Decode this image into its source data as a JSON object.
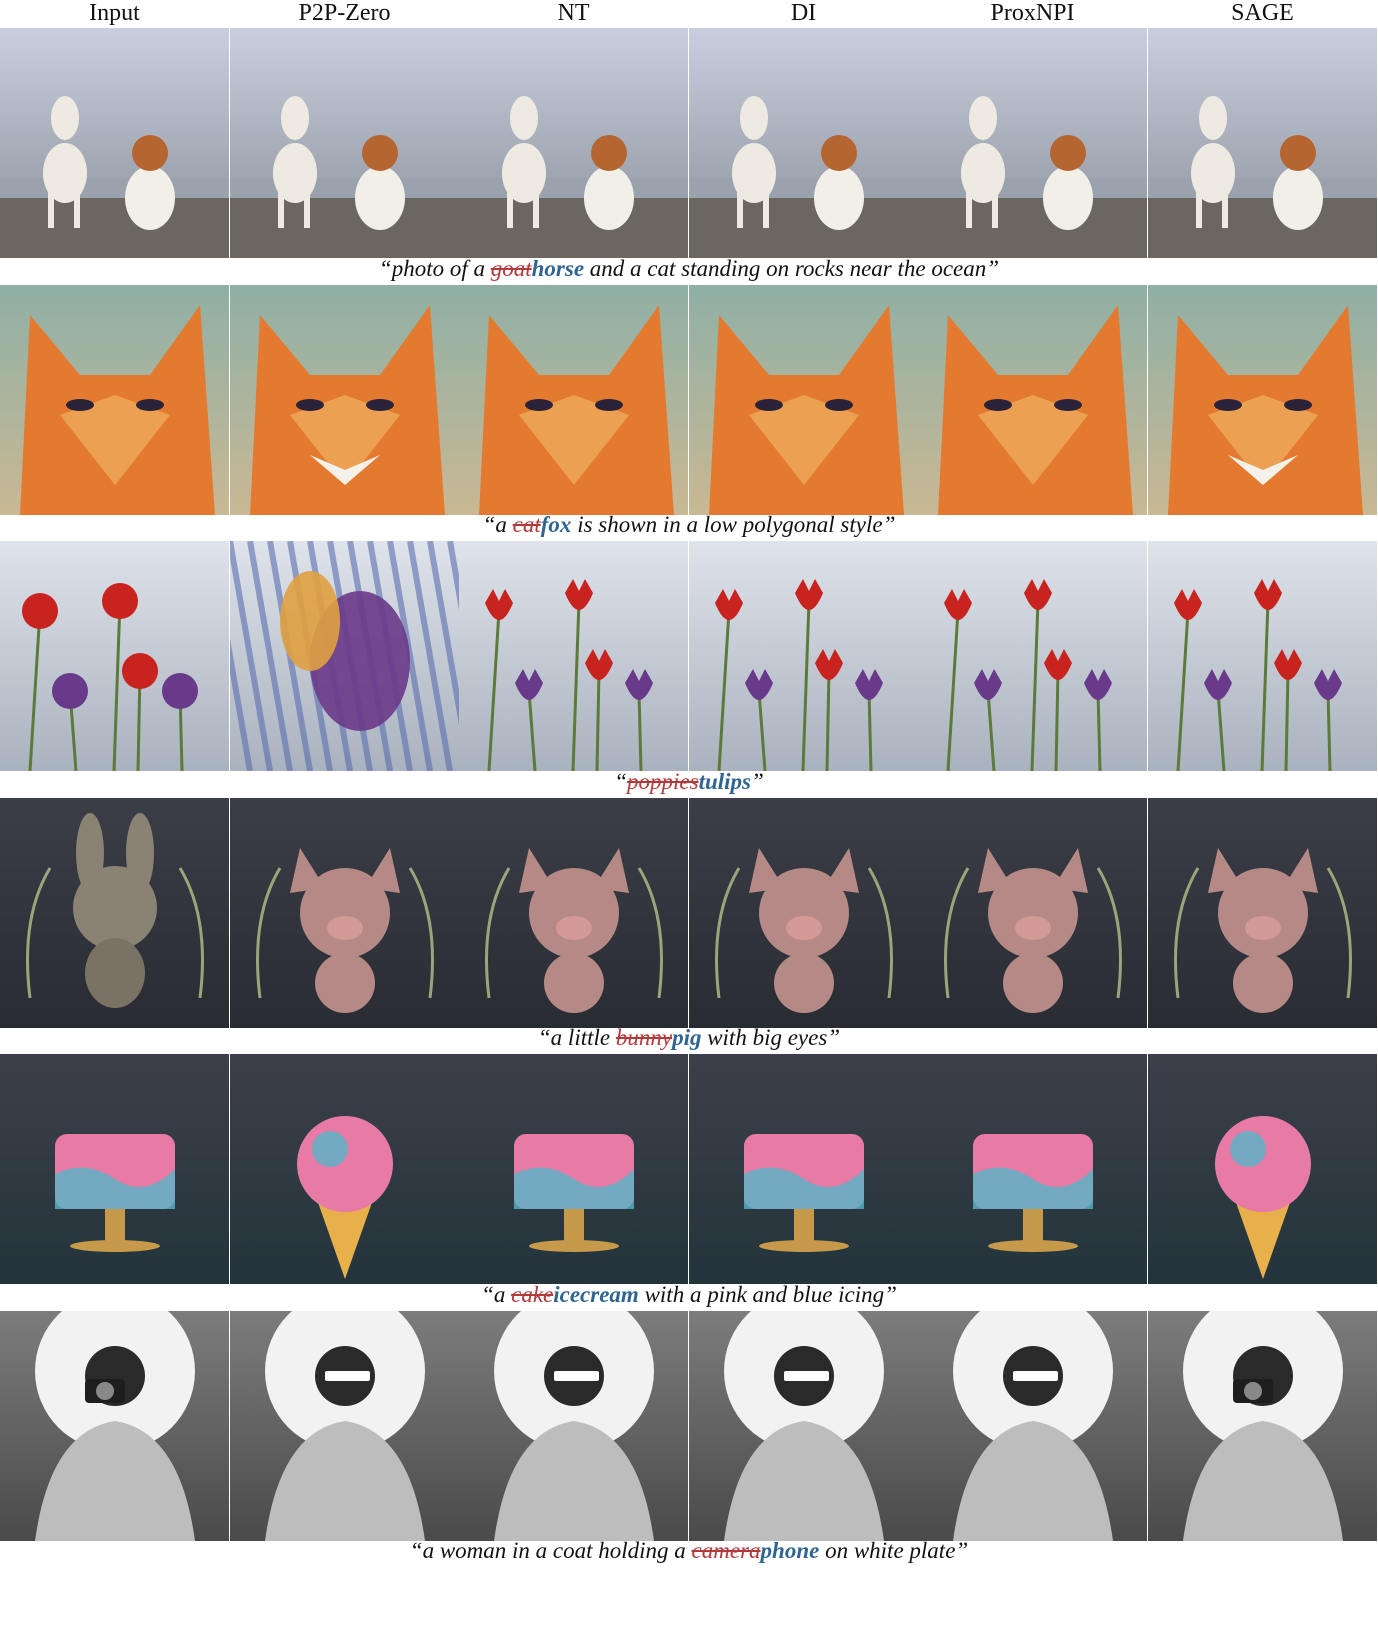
{
  "columns": [
    "Input",
    "P2P-Zero",
    "NT",
    "DI",
    "ProxNPI",
    "SAGE"
  ],
  "rows": [
    {
      "subject_icons": [
        "goat-icon",
        "horse-icon",
        "horse-icon",
        "horse-icon",
        "horse-icon",
        "horse-icon"
      ],
      "colors": {
        "bg_top": "#c7cfe0",
        "bg_bottom": "#8a8f96",
        "ground": "#6b6660",
        "subject": "#eeeae2",
        "accent": "#b5652f"
      },
      "caption": {
        "pre": "“photo of a ",
        "old": "goat",
        "new": "horse",
        "post": " and a cat standing on rocks near the ocean”"
      }
    },
    {
      "subject_icons": [
        "cat-icon",
        "fox-icon",
        "cat-icon",
        "cat-icon",
        "cat-icon",
        "fox-icon"
      ],
      "colors": {
        "bg_top": "#8fb0a6",
        "bg_bottom": "#c9b893",
        "ground": "#c55a2a",
        "subject": "#e47a30",
        "accent": "#f0b060"
      },
      "caption": {
        "pre": "“a ",
        "old": "cat",
        "new": "fox",
        "post": " is shown in a low polygonal style”"
      }
    },
    {
      "subject_icons": [
        "poppy-icon",
        "abstract-texture-icon",
        "tulip-icon",
        "tulip-icon",
        "tulip-icon",
        "tulip-icon"
      ],
      "colors": {
        "bg_top": "#dfe3ea",
        "bg_bottom": "#a9b2be",
        "ground": "#3f5a2a",
        "subject": "#c8231f",
        "accent": "#6a3a8a"
      },
      "caption": {
        "pre": "“",
        "old": "poppies",
        "new": "tulips",
        "post": "”"
      }
    },
    {
      "subject_icons": [
        "bunny-icon",
        "pig-icon",
        "pig-icon",
        "pig-icon",
        "pig-icon",
        "pig-icon"
      ],
      "colors": {
        "bg_top": "#3b3e47",
        "bg_bottom": "#2a2c33",
        "ground": "#4c5a3e",
        "subject": "#b58a86",
        "accent": "#9aa67a"
      },
      "caption": {
        "pre": "“a little ",
        "old": "bunny",
        "new": "pig",
        "post": " with big eyes”"
      }
    },
    {
      "subject_icons": [
        "cake-icon",
        "ice-cream-icon",
        "cake-icon",
        "cake-icon",
        "cake-icon",
        "ice-cream-icon"
      ],
      "colors": {
        "bg_top": "#3d3f4a",
        "bg_bottom": "#23343b",
        "ground": "#2b474d",
        "subject": "#e87aa6",
        "accent": "#55b6c8"
      },
      "caption": {
        "pre": "“a ",
        "old": "cake",
        "new": "icecream",
        "post": " with a pink and blue icing”"
      }
    },
    {
      "subject_icons": [
        "camera-icon",
        "phone-icon",
        "phone-icon",
        "phone-icon",
        "phone-icon",
        "camera-icon"
      ],
      "colors": {
        "bg_top": "#7c7c7c",
        "bg_bottom": "#4a4a4a",
        "ground": "#f2f2f2",
        "subject": "#bdbdbd",
        "accent": "#1e1e1e"
      },
      "caption": {
        "pre": "“a woman in a coat holding a ",
        "old": "camera",
        "new": "phone",
        "post": " on white plate”"
      }
    }
  ]
}
